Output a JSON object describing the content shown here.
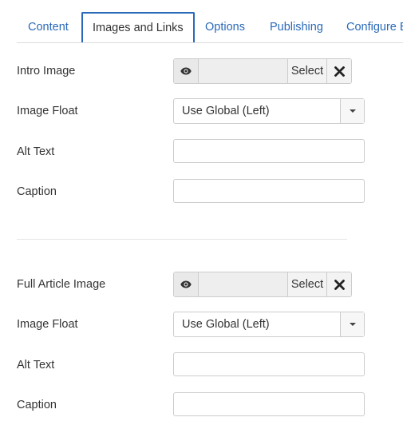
{
  "tabs": [
    {
      "label": "Content",
      "active": false
    },
    {
      "label": "Images and Links",
      "active": true
    },
    {
      "label": "Options",
      "active": false
    },
    {
      "label": "Publishing",
      "active": false
    },
    {
      "label": "Configure E",
      "active": false
    }
  ],
  "intro": {
    "image_label": "Intro Image",
    "select_button": "Select",
    "float_label": "Image Float",
    "float_value": "Use Global (Left)",
    "alt_label": "Alt Text",
    "alt_value": "",
    "caption_label": "Caption",
    "caption_value": ""
  },
  "full": {
    "image_label": "Full Article Image",
    "select_button": "Select",
    "float_label": "Image Float",
    "float_value": "Use Global (Left)",
    "alt_label": "Alt Text",
    "alt_value": "",
    "caption_label": "Caption",
    "caption_value": ""
  },
  "colors": {
    "accent": "#2a69b8",
    "border": "#cccccc"
  },
  "icons": {
    "preview": "eye-icon",
    "clear": "close-icon",
    "dropdown": "chevron-down-icon"
  }
}
